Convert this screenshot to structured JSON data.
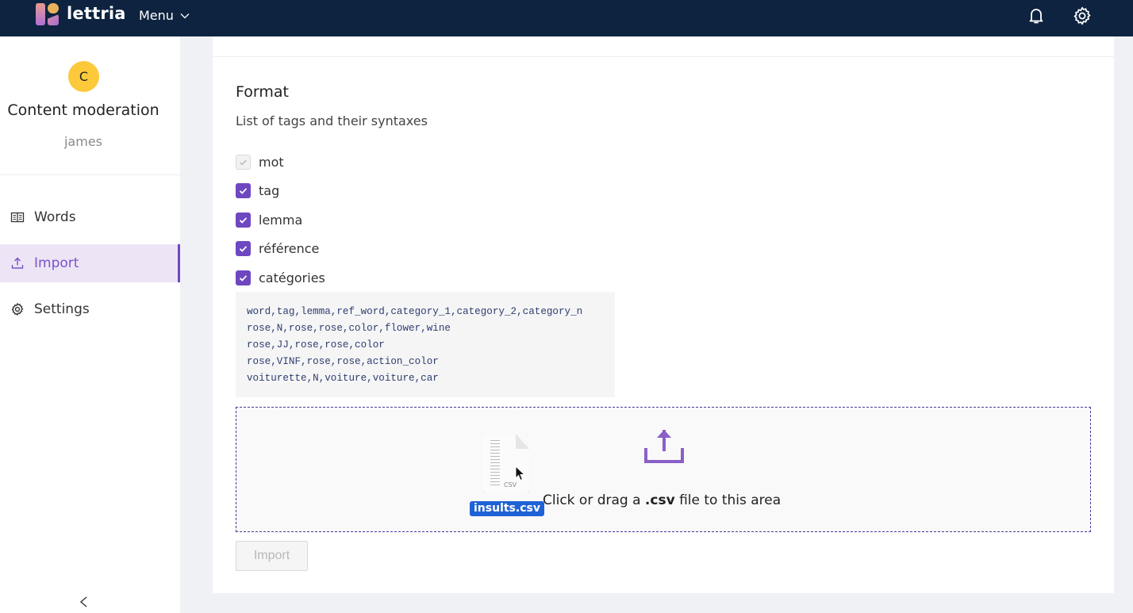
{
  "header": {
    "brand": "lettria",
    "menu_label": "Menu",
    "icons": [
      "bell-icon",
      "gear-icon"
    ]
  },
  "sidebar": {
    "avatar_letter": "C",
    "avatar_color": "#fcc93a",
    "project_name": "Content moderation",
    "owner": "james",
    "items": [
      {
        "label": "Words",
        "icon": "book-icon",
        "active": false
      },
      {
        "label": "Import",
        "icon": "upload-icon",
        "active": true
      },
      {
        "label": "Settings",
        "icon": "gear-icon",
        "active": false
      }
    ],
    "collapse_icon": "chevron-left-icon"
  },
  "main": {
    "section_title": "Format",
    "section_subtitle": "List of tags and their syntaxes",
    "tags": [
      {
        "label": "mot",
        "checked": true,
        "disabled": true
      },
      {
        "label": "tag",
        "checked": true,
        "disabled": false
      },
      {
        "label": "lemma",
        "checked": true,
        "disabled": false
      },
      {
        "label": "référence",
        "checked": true,
        "disabled": false
      },
      {
        "label": "catégories",
        "checked": true,
        "disabled": false
      }
    ],
    "example_lines": [
      "word,tag,lemma,ref_word,category_1,category_2,category_n",
      "rose,N,rose,rose,color,flower,wine",
      "rose,JJ,rose,rose,color",
      "rose,VINF,rose,rose,action_color",
      "voiturette,N,voiture,voiture,car"
    ],
    "dropzone": {
      "text_prefix": "Click or drag a ",
      "text_bold": ".csv",
      "text_suffix": " file to this area",
      "dragged_file": "insults.csv",
      "dragged_file_ext": "CSV"
    },
    "import_button": "Import"
  },
  "colors": {
    "topbar": "#0d2340",
    "accent": "#6e47c1",
    "active_bg": "#ede5f6",
    "file_label": "#1f62d6"
  }
}
